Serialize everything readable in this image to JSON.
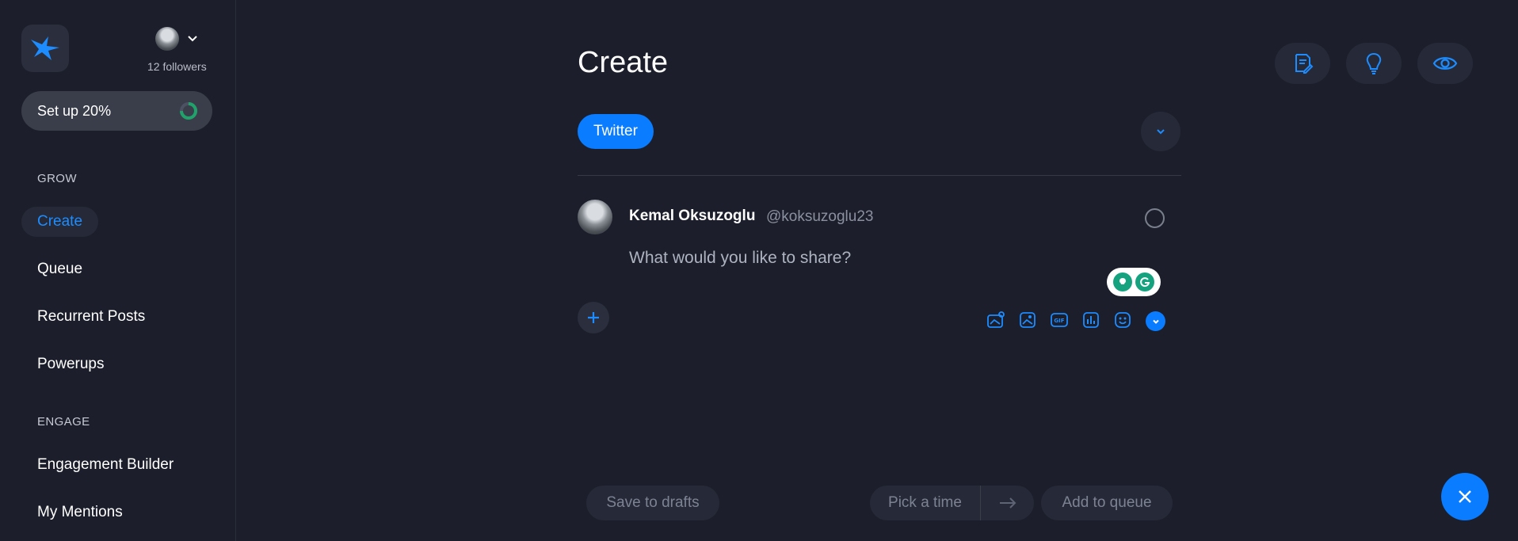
{
  "account": {
    "followers": "12 followers"
  },
  "setup": {
    "label": "Set up 20%",
    "progress": 0.2
  },
  "nav": {
    "grow_heading": "GROW",
    "grow_items": [
      "Create",
      "Queue",
      "Recurrent Posts",
      "Powerups"
    ],
    "engage_heading": "ENGAGE",
    "engage_items": [
      "Engagement Builder",
      "My Mentions"
    ],
    "active": "Create"
  },
  "main": {
    "title": "Create",
    "platform": "Twitter",
    "post": {
      "name": "Kemal Oksuzoglu",
      "handle": "@koksuzoglu23",
      "placeholder": "What would you like to share?"
    }
  },
  "actions": {
    "save_drafts": "Save to drafts",
    "pick_time": "Pick a time",
    "add_queue": "Add to queue"
  },
  "colors": {
    "background": "#1c1f2b",
    "accent": "#0a7cff",
    "surface": "#262a38"
  },
  "icons": {
    "top_buttons": [
      "notes-icon",
      "lightbulb-icon",
      "eye-icon"
    ],
    "toolbar": [
      "media-library-icon",
      "image-icon",
      "gif-icon",
      "poll-icon",
      "emoji-icon",
      "chevron-down-icon"
    ]
  }
}
